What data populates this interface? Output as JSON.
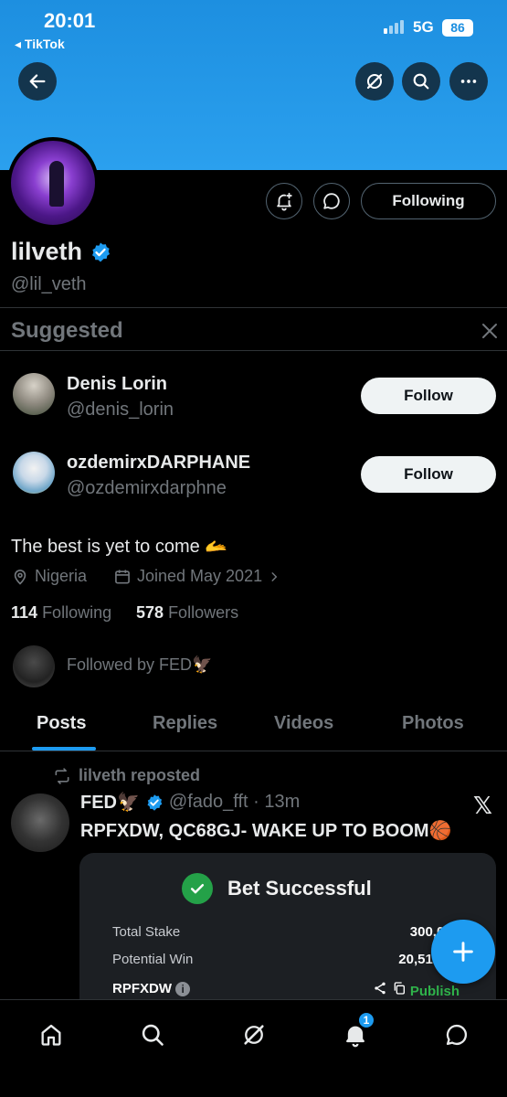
{
  "status_bar": {
    "time": "20:01",
    "back_app": "◂ TikTok",
    "network": "5G",
    "battery": "86"
  },
  "profile": {
    "display_name": "lilveth",
    "handle": "@lil_veth",
    "following_button": "Following",
    "bio": "The best is yet to come 🫴",
    "location": "Nigeria",
    "joined": "Joined May 2021",
    "following_count": "114",
    "following_label": "Following",
    "followers_count": "578",
    "followers_label": "Followers",
    "followed_by": "Followed by FED🦅"
  },
  "suggested": {
    "title": "Suggested",
    "users": [
      {
        "name": "Denis Lorin",
        "handle": "@denis_lorin",
        "button": "Follow"
      },
      {
        "name": "ozdemirxDARPHANE",
        "handle": "@ozdemirxdarphne",
        "button": "Follow"
      }
    ]
  },
  "tabs": [
    "Posts",
    "Replies",
    "Videos",
    "Photos"
  ],
  "post": {
    "repost_label": "lilveth reposted",
    "author": "FED🦅",
    "handle_time": "@fado_fft · 13m",
    "text": "RPFXDW, QC68GJ- WAKE UP TO BOOM🏀",
    "card": {
      "title": "Bet Successful",
      "rows": [
        {
          "label": "Total Stake",
          "value": "300,000"
        },
        {
          "label": "Potential Win",
          "value": "20,518,61"
        }
      ],
      "code": "RPFXDW",
      "publish": "Publish"
    }
  },
  "nav": {
    "notification_count": "1"
  },
  "colors": {
    "accent": "#1d9bf0",
    "background": "#000000",
    "muted": "#71767b",
    "success": "#24a148"
  }
}
